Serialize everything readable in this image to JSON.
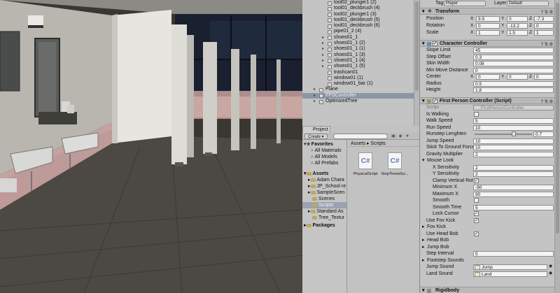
{
  "hierarchy": {
    "items": [
      {
        "label": "tool02_plunger1 (2)",
        "kind": "object"
      },
      {
        "label": "tool01_deckbrush (4)",
        "kind": "object"
      },
      {
        "label": "tool02_plunger1 (3)",
        "kind": "object"
      },
      {
        "label": "tool01_deckbrush (5)",
        "kind": "object"
      },
      {
        "label": "tool01_deckbrush (6)",
        "kind": "object"
      },
      {
        "label": "pipe01_2 (4)",
        "kind": "object"
      },
      {
        "label": "shoes01_1",
        "kind": "object"
      },
      {
        "label": "shoes01_1 (2)",
        "kind": "object"
      },
      {
        "label": "shoes01_1 (1)",
        "kind": "object"
      },
      {
        "label": "shoes01_1 (3)",
        "kind": "object"
      },
      {
        "label": "shoes01_1 (4)",
        "kind": "object"
      },
      {
        "label": "shoes01_1 (5)",
        "kind": "object"
      },
      {
        "label": "trashcan01",
        "kind": "object"
      },
      {
        "label": "window01 (1)",
        "kind": "object"
      },
      {
        "label": "window01_bar (1)",
        "kind": "object"
      },
      {
        "label": "Plane",
        "kind": "root"
      },
      {
        "label": "FPSController",
        "kind": "root-selected"
      },
      {
        "label": "OptimizedTree",
        "kind": "root"
      }
    ]
  },
  "project": {
    "tab_label": "Project",
    "create_label": "Create",
    "favorites": {
      "label": "Favorites",
      "items": [
        "All Materials",
        "All Models",
        "All Prefabs"
      ]
    },
    "assets": {
      "label": "Assets",
      "items": [
        "Adam Chara",
        "JP_School re",
        "SampleScen",
        "Scenes",
        "Scripts",
        "Standard As",
        "Tree_Textur"
      ]
    },
    "packages_label": "Packages",
    "breadcrumb": "Assets ▸ Scripts",
    "files": [
      {
        "name": "PhysicalScript",
        "glyph": "C#"
      },
      {
        "name": "StopThrewScr...",
        "glyph": "C#"
      }
    ]
  },
  "inspector": {
    "tag": {
      "label": "Tag",
      "value": "Player"
    },
    "layer": {
      "label": "Layer",
      "value": "Default"
    },
    "transform": {
      "title": "Transform",
      "position": {
        "label": "Position",
        "x": "9.9",
        "y": "0",
        "z": "-7.3"
      },
      "rotation": {
        "label": "Rotation",
        "x": "0",
        "y": "-13.2",
        "z": "0"
      },
      "scale": {
        "label": "Scale",
        "x": "1",
        "y": "1.5",
        "z": "1"
      }
    },
    "character_controller": {
      "title": "Character Controller",
      "slope_limit": {
        "label": "Slope Limit",
        "value": "45"
      },
      "step_offset": {
        "label": "Step Offset",
        "value": "0.3"
      },
      "skin_width": {
        "label": "Skin Width",
        "value": "0.08"
      },
      "min_move_distance": {
        "label": "Min Move Distance",
        "value": "0"
      },
      "center": {
        "label": "Center",
        "x": "0",
        "y": "0",
        "z": "0"
      },
      "radius": {
        "label": "Radius",
        "value": "0.5"
      },
      "height": {
        "label": "Height",
        "value": "1.8"
      }
    },
    "fps_controller": {
      "title": "First Person Controller (Script)",
      "script": {
        "label": "Script",
        "value": "FirstPersonController"
      },
      "is_walking": {
        "label": "Is Walking",
        "checked": false
      },
      "walk_speed": {
        "label": "Walk Speed",
        "value": "5"
      },
      "run_speed": {
        "label": "Run Speed",
        "value": "10"
      },
      "runstep_lenghten": {
        "label": "Runstep Lenghten",
        "value": "0.7",
        "fraction": 0.7
      },
      "jump_speed": {
        "label": "Jump Speed",
        "value": "10"
      },
      "stick_to_ground": {
        "label": "Stick To Ground Force",
        "value": "10"
      },
      "gravity_multiplier": {
        "label": "Gravity Multiplier",
        "value": "2"
      },
      "mouse_look": {
        "label": "Mouse Look"
      },
      "x_sensitivity": {
        "label": "X Sensitivity",
        "value": "2"
      },
      "y_sensitivity": {
        "label": "Y Sensitivity",
        "value": "2"
      },
      "clamp_vertical": {
        "label": "Clamp Vertical Rotati",
        "checked": true
      },
      "minimum_x": {
        "label": "Minimum X",
        "value": "-90"
      },
      "maximum_x": {
        "label": "Maximum X",
        "value": "90"
      },
      "smooth": {
        "label": "Smooth",
        "checked": false
      },
      "smooth_time": {
        "label": "Smooth Time",
        "value": "5"
      },
      "lock_cursor": {
        "label": "Lock Cursor",
        "checked": true
      },
      "use_fov_kick": {
        "label": "Use Fov Kick",
        "checked": true
      },
      "fov_kick": {
        "label": "Fov Kick"
      },
      "use_head_bob": {
        "label": "Use Head Bob",
        "checked": true
      },
      "head_bob": {
        "label": "Head Bob"
      },
      "jump_bob": {
        "label": "Jump Bob"
      },
      "step_interval": {
        "label": "Step Interval",
        "value": "5"
      },
      "footstep_sounds": {
        "label": "Footstep Sounds"
      },
      "jump_sound": {
        "label": "Jump Sound",
        "value": "Jump"
      },
      "land_sound": {
        "label": "Land Sound",
        "value": "Land"
      }
    },
    "rigidbody_title": "Rigidbody"
  }
}
